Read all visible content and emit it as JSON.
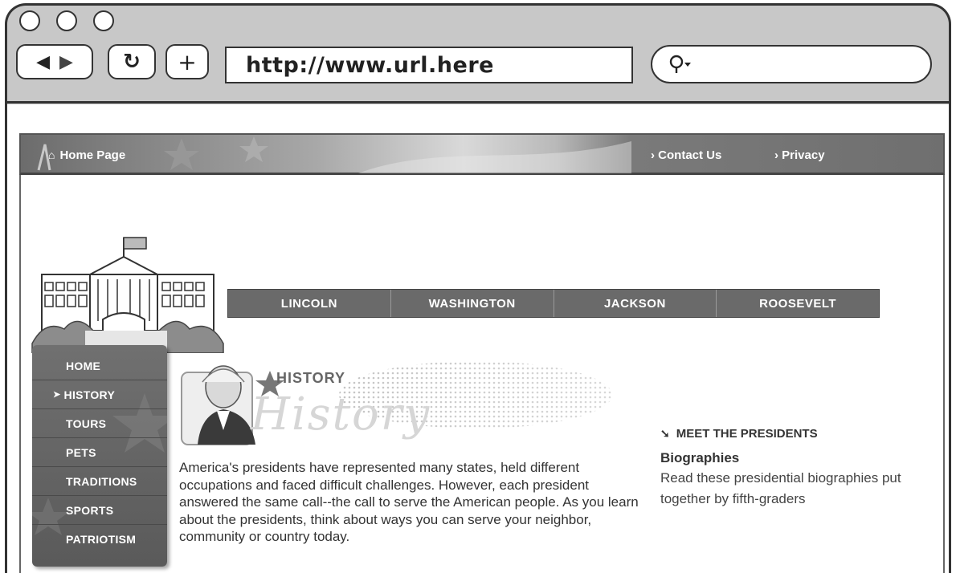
{
  "browser": {
    "url": "http://www.url.here",
    "search_icon": "search-icon"
  },
  "site": {
    "top_nav": {
      "home": "Home Page",
      "contact": "› Contact Us",
      "privacy": "› Privacy"
    },
    "tabs": [
      "LINCOLN",
      "WASHINGTON",
      "JACKSON",
      "ROOSEVELT"
    ],
    "sidebar": [
      "HOME",
      "HISTORY",
      "TOURS",
      "PETS",
      "TRADITIONS",
      "SPORTS",
      "PATRIOTISM"
    ],
    "sidebar_active": "HISTORY",
    "hero": {
      "label": "HISTORY",
      "script_text": "History"
    },
    "intro": "America's presidents have represented many states, held different occupations and faced difficult challenges. However, each president answered the same call--the call to serve the American people. As you learn about the presidents, think about ways you can serve your neighbor, community or country today.",
    "meet": {
      "heading": "MEET THE PRESIDENTS",
      "title": "Biographies",
      "text": "Read these presidential biographies put together by fifth-graders"
    }
  }
}
